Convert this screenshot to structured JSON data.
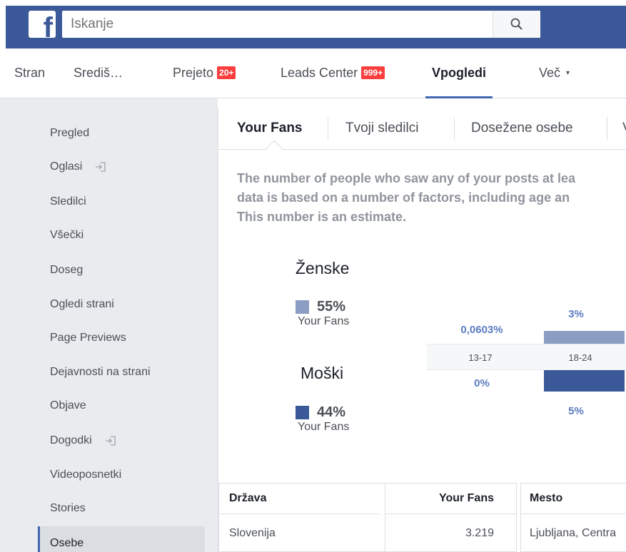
{
  "search": {
    "placeholder": "Iskanje"
  },
  "pagenav": [
    {
      "label": "Stran"
    },
    {
      "label": "Središ…"
    },
    {
      "label": "Prejeto",
      "badge": "20+"
    },
    {
      "label": "Leads Center",
      "badge": "999+"
    },
    {
      "label": "Vpogledi",
      "active": true
    },
    {
      "label": "Več",
      "caret": "▾"
    }
  ],
  "sidebar": {
    "items": [
      {
        "label": "Pregled"
      },
      {
        "label": "Oglasi",
        "icon": "external-enter-icon"
      },
      {
        "label": "Sledilci"
      },
      {
        "label": "Všečki"
      },
      {
        "label": "Doseg"
      },
      {
        "label": "Ogledi strani"
      },
      {
        "label": "Page Previews"
      },
      {
        "label": "Dejavnosti na strani"
      },
      {
        "label": "Objave"
      },
      {
        "label": "Dogodki",
        "icon": "external-enter-icon"
      },
      {
        "label": "Videoposnetki"
      },
      {
        "label": "Stories"
      },
      {
        "label": "Osebe",
        "active": true
      }
    ]
  },
  "subtabs": [
    {
      "label": "Your Fans",
      "active": true
    },
    {
      "label": "Tvoji sledilci"
    },
    {
      "label": "Dosežene osebe"
    },
    {
      "label": "V"
    }
  ],
  "description": [
    "The number of people who saw any of your posts at lea",
    "data is based on a number of factors, including age an",
    "This number is an estimate."
  ],
  "gender": {
    "women": {
      "label": "Ženske",
      "percent": "55%",
      "sub": "Your Fans",
      "color": "#8b9dc3"
    },
    "men": {
      "label": "Moški",
      "percent": "44%",
      "sub": "Your Fans",
      "color": "#3b5998"
    }
  },
  "chart_data": {
    "type": "bar",
    "categories": [
      "13-17",
      "18-24"
    ],
    "series": [
      {
        "name": "Ženske",
        "values": [
          0.0603,
          3
        ],
        "labels": [
          "0,0603%",
          "3%"
        ],
        "color": "#8b9dc3"
      },
      {
        "name": "Moški",
        "values": [
          0,
          5
        ],
        "labels": [
          "0%",
          "5%"
        ],
        "color": "#3b5998"
      }
    ],
    "unit": "%"
  },
  "table_country": {
    "headers": [
      "Država",
      "Your Fans"
    ],
    "rows": [
      [
        "Slovenija",
        "3.219"
      ]
    ]
  },
  "table_city": {
    "headers": [
      "Mesto"
    ],
    "rows": [
      [
        "Ljubljana, Centra"
      ]
    ]
  }
}
